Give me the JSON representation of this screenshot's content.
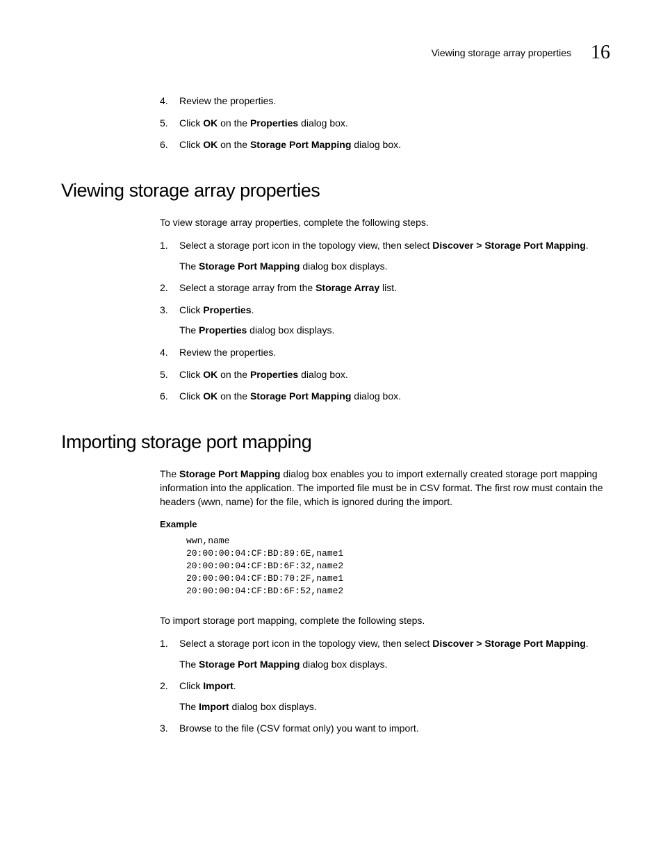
{
  "header": {
    "running_title": "Viewing storage array properties",
    "chapter_number": "16"
  },
  "top_steps": [
    {
      "n": "4.",
      "runs": [
        {
          "t": "Review the properties."
        }
      ]
    },
    {
      "n": "5.",
      "runs": [
        {
          "t": "Click "
        },
        {
          "t": "OK",
          "b": true
        },
        {
          "t": " on the "
        },
        {
          "t": "Properties",
          "b": true
        },
        {
          "t": " dialog box."
        }
      ]
    },
    {
      "n": "6.",
      "runs": [
        {
          "t": "Click "
        },
        {
          "t": "OK",
          "b": true
        },
        {
          "t": " on the "
        },
        {
          "t": "Storage Port Mapping",
          "b": true
        },
        {
          "t": " dialog box."
        }
      ]
    }
  ],
  "section1": {
    "heading": "Viewing storage array properties",
    "intro": [
      {
        "t": "To view storage array properties, complete the following steps."
      }
    ],
    "steps": [
      {
        "n": "1.",
        "runs": [
          {
            "t": "Select a storage port icon in the topology view, then select "
          },
          {
            "t": "Discover > Storage Port Mapping",
            "b": true
          },
          {
            "t": "."
          }
        ],
        "sub": [
          {
            "t": "The "
          },
          {
            "t": "Storage Port Mapping",
            "b": true
          },
          {
            "t": " dialog box displays."
          }
        ]
      },
      {
        "n": "2.",
        "runs": [
          {
            "t": "Select a storage array from the "
          },
          {
            "t": "Storage Array",
            "b": true
          },
          {
            "t": " list."
          }
        ]
      },
      {
        "n": "3.",
        "runs": [
          {
            "t": "Click "
          },
          {
            "t": "Properties",
            "b": true
          },
          {
            "t": "."
          }
        ],
        "sub": [
          {
            "t": "The "
          },
          {
            "t": "Properties",
            "b": true
          },
          {
            "t": " dialog box displays."
          }
        ]
      },
      {
        "n": "4.",
        "runs": [
          {
            "t": "Review the properties."
          }
        ]
      },
      {
        "n": "5.",
        "runs": [
          {
            "t": "Click "
          },
          {
            "t": "OK",
            "b": true
          },
          {
            "t": " on the "
          },
          {
            "t": "Properties",
            "b": true
          },
          {
            "t": " dialog box."
          }
        ]
      },
      {
        "n": "6.",
        "runs": [
          {
            "t": "Click "
          },
          {
            "t": "OK",
            "b": true
          },
          {
            "t": " on the "
          },
          {
            "t": "Storage Port Mapping",
            "b": true
          },
          {
            "t": " dialog box."
          }
        ]
      }
    ]
  },
  "section2": {
    "heading": "Importing storage port mapping",
    "intro": [
      {
        "t": "The "
      },
      {
        "t": "Storage Port Mapping",
        "b": true
      },
      {
        "t": " dialog box enables you to import externally created storage port mapping information into the application. The imported file must be in CSV format. The first row must contain the headers (wwn, name) for the file, which is ignored during the import."
      }
    ],
    "example_label": "Example",
    "example_code": "wwn,name\n20:00:00:04:CF:BD:89:6E,name1\n20:00:00:04:CF:BD:6F:32,name2\n20:00:00:04:CF:BD:70:2F,name1\n20:00:00:04:CF:BD:6F:52,name2",
    "intro2": [
      {
        "t": "To import storage port mapping, complete the following steps."
      }
    ],
    "steps": [
      {
        "n": "1.",
        "runs": [
          {
            "t": "Select a storage port icon in the topology view, then select "
          },
          {
            "t": "Discover > Storage Port Mapping",
            "b": true
          },
          {
            "t": "."
          }
        ],
        "sub": [
          {
            "t": "The "
          },
          {
            "t": "Storage Port Mapping",
            "b": true
          },
          {
            "t": " dialog box displays."
          }
        ]
      },
      {
        "n": "2.",
        "runs": [
          {
            "t": "Click "
          },
          {
            "t": "Import",
            "b": true
          },
          {
            "t": "."
          }
        ],
        "sub": [
          {
            "t": "The "
          },
          {
            "t": "Import",
            "b": true
          },
          {
            "t": " dialog box displays."
          }
        ]
      },
      {
        "n": "3.",
        "runs": [
          {
            "t": "Browse to the file (CSV format only) you want to import."
          }
        ]
      }
    ]
  }
}
